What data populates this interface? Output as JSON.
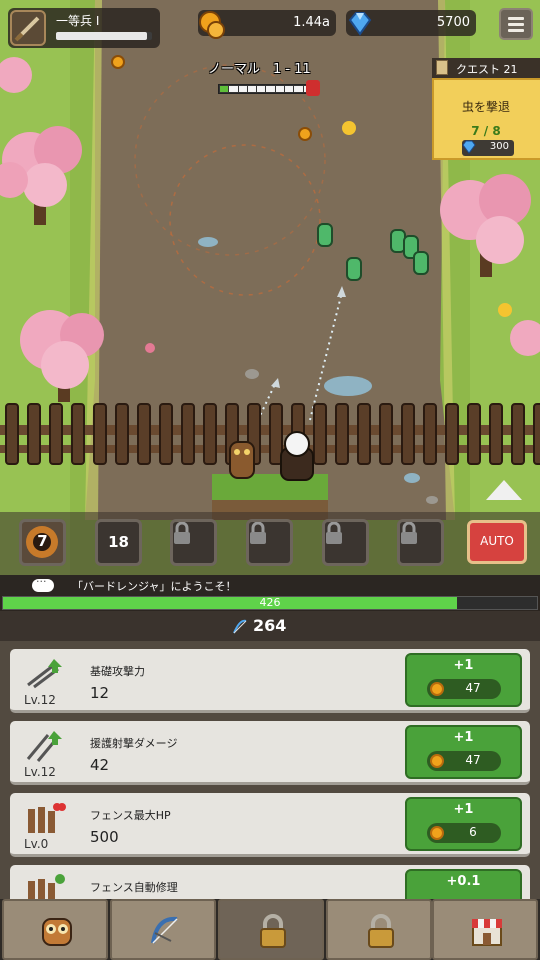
{
  "hud": {
    "rank": "一等兵 I",
    "rank_progress": 0.95,
    "coins": "1.44a",
    "gems": "5700",
    "menu_icon": "hamburger-menu-icon"
  },
  "stage": {
    "label": "ノーマル　1 - 11",
    "waves_total": 10,
    "waves_done": 1
  },
  "quest": {
    "header": "クエスト 21",
    "title": "虫を撃退",
    "progress": "7 / 8",
    "reward": "300"
  },
  "skills": [
    {
      "name": "eagle-eye-skill",
      "value": "7",
      "locked": false
    },
    {
      "name": "fire-skill",
      "value": "18",
      "locked": false
    },
    {
      "name": "locked-skill",
      "locked": true
    },
    {
      "name": "locked-skill",
      "locked": true
    },
    {
      "name": "locked-skill",
      "locked": true
    },
    {
      "name": "locked-skill",
      "locked": true
    }
  ],
  "auto_label": "AUTO",
  "message": "「バードレンジャ」にようこそ！",
  "fence_hp": {
    "value": "426",
    "fraction": 0.85
  },
  "power": "264",
  "upgrades": [
    {
      "name": "基礎攻撃力",
      "level": "Lv.12",
      "value": "12",
      "inc": "+1",
      "cost": "47",
      "icon": "arrows-upgrade-icon"
    },
    {
      "name": "援護射撃ダメージ",
      "level": "Lv.12",
      "value": "42",
      "inc": "+1",
      "cost": "47",
      "icon": "support-arrows-upgrade-icon"
    },
    {
      "name": "フェンス最大HP",
      "level": "Lv.0",
      "value": "500",
      "inc": "+1",
      "cost": "6",
      "icon": "fence-hp-icon"
    },
    {
      "name": "フェンス自動修理",
      "level": "",
      "value": "",
      "inc": "+0.1",
      "cost": "",
      "icon": "fence-repair-icon"
    }
  ],
  "tabs": [
    {
      "name": "tab-owl",
      "icon": "owl-icon"
    },
    {
      "name": "tab-bow",
      "icon": "bow-icon"
    },
    {
      "name": "tab-locked-1",
      "icon": "lock-icon"
    },
    {
      "name": "tab-locked-2",
      "icon": "lock-icon"
    },
    {
      "name": "tab-shop",
      "icon": "shop-icon"
    }
  ],
  "colors": {
    "hp_green": "#5fd34a",
    "upgrade_button": "#4aa23a",
    "auto_red": "#d6423f",
    "quest_yellow": "#f2cf5a"
  }
}
